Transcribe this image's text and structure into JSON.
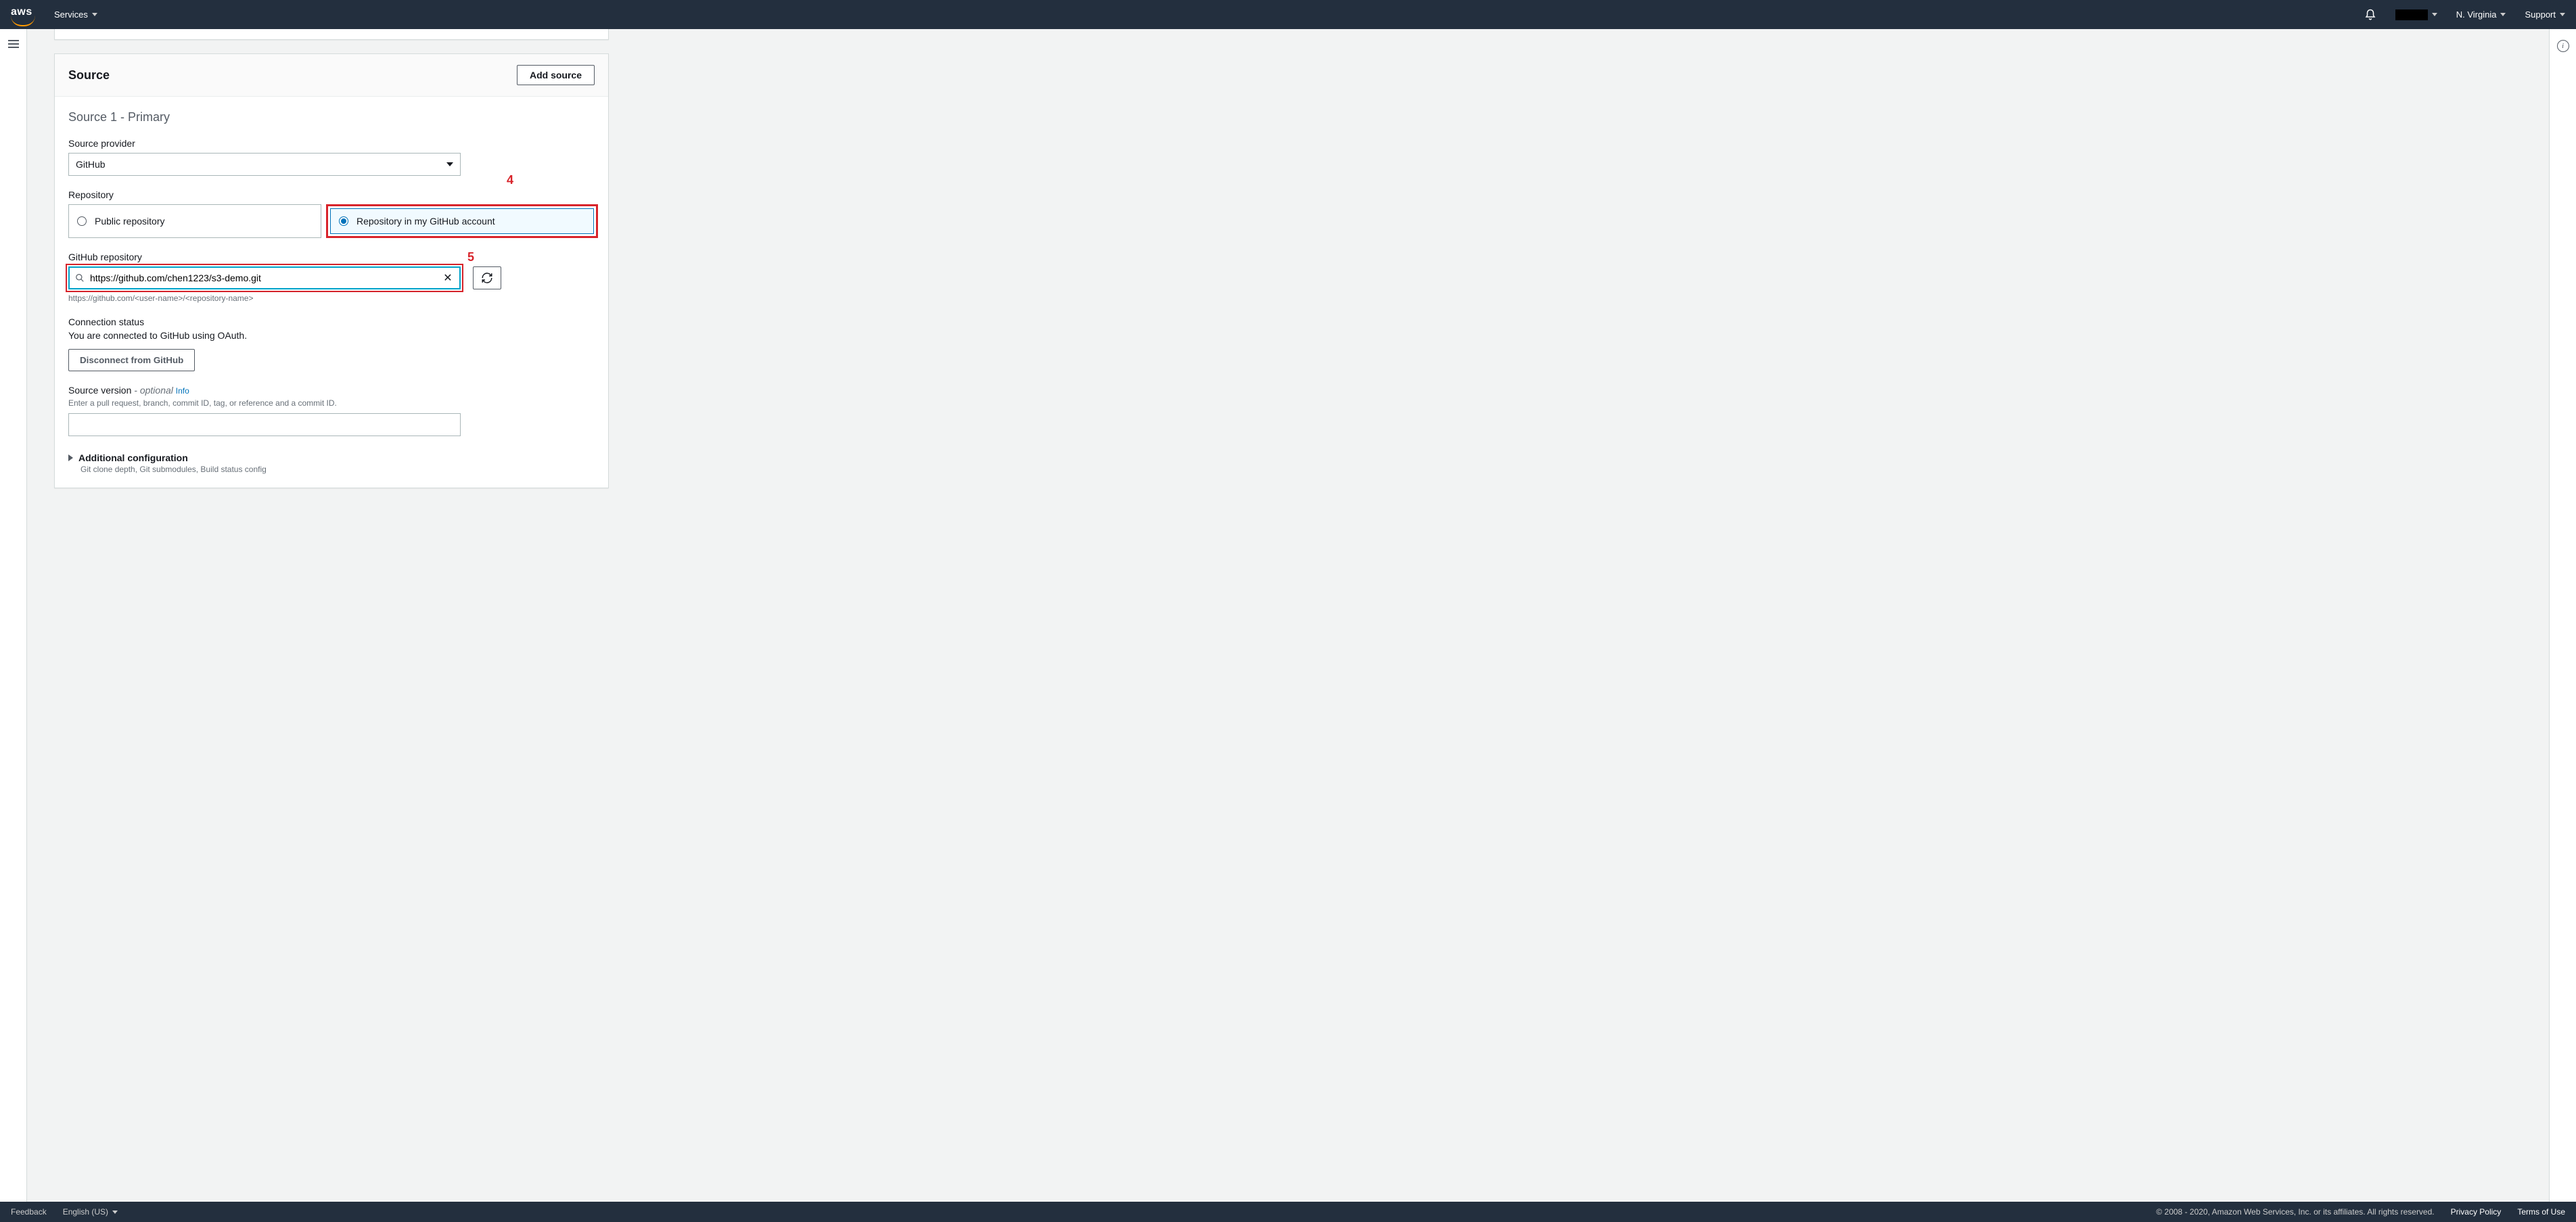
{
  "nav": {
    "services": "Services",
    "region": "N. Virginia",
    "support": "Support"
  },
  "panel": {
    "title": "Source",
    "add_source": "Add source",
    "section_title": "Source 1 - Primary",
    "source_provider_label": "Source provider",
    "source_provider_value": "GitHub",
    "repository_label": "Repository",
    "repo_option_public": "Public repository",
    "repo_option_account": "Repository in my GitHub account",
    "github_repo_label": "GitHub repository",
    "github_repo_value": "https://github.com/chen1223/s3-demo.git",
    "github_repo_hint": "https://github.com/<user-name>/<repository-name>",
    "conn_status_label": "Connection status",
    "conn_status_msg": "You are connected to GitHub using OAuth.",
    "disconnect_label": "Disconnect from GitHub",
    "sv_label": "Source version",
    "sv_optional": " - optional",
    "sv_info": "Info",
    "sv_hint": "Enter a pull request, branch, commit ID, tag, or reference and a commit ID.",
    "addl_title": "Additional configuration",
    "addl_sub": "Git clone depth, Git submodules, Build status config"
  },
  "annotations": {
    "four": "4",
    "five": "5"
  },
  "footer": {
    "feedback": "Feedback",
    "lang": "English (US)",
    "copyright": "© 2008 - 2020, Amazon Web Services, Inc. or its affiliates. All rights reserved.",
    "privacy": "Privacy Policy",
    "terms": "Terms of Use"
  }
}
